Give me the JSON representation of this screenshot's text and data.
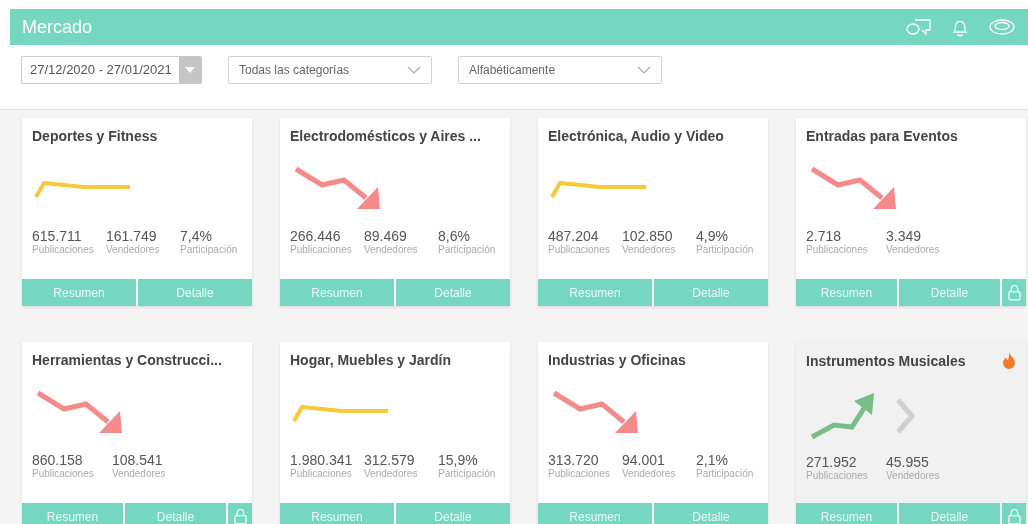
{
  "header": {
    "title": "Mercado"
  },
  "filters": {
    "date_range": "27/12/2020 - 27/01/2021",
    "category": "Todas las categorías",
    "sort": "Alfabéticamente"
  },
  "cards": [
    {
      "title": "Deportes y Fitness",
      "kind": "flat",
      "stats": [
        {
          "value": "615.711",
          "label": "Publicaciones"
        },
        {
          "value": "161.749",
          "label": "Vendedores"
        },
        {
          "value": "7,4%",
          "label": "Participación"
        }
      ],
      "buttons": [
        "Resumen",
        "Detalle"
      ],
      "locked": false,
      "hot": false,
      "highlighted": false
    },
    {
      "title": "Electrodomésticos y Aires ...",
      "kind": "down",
      "stats": [
        {
          "value": "266.446",
          "label": "Publicaciones"
        },
        {
          "value": "89.469",
          "label": "Vendedores"
        },
        {
          "value": "8,6%",
          "label": "Participación"
        }
      ],
      "buttons": [
        "Resumen",
        "Detalle"
      ],
      "locked": false,
      "hot": false,
      "highlighted": false
    },
    {
      "title": "Electrónica, Audio y Video",
      "kind": "flat",
      "stats": [
        {
          "value": "487.204",
          "label": "Publicaciones"
        },
        {
          "value": "102.850",
          "label": "Vendedores"
        },
        {
          "value": "4,9%",
          "label": "Participación"
        }
      ],
      "buttons": [
        "Resumen",
        "Detalle"
      ],
      "locked": false,
      "hot": false,
      "highlighted": false
    },
    {
      "title": "Entradas para Eventos",
      "kind": "down",
      "stats": [
        {
          "value": "2.718",
          "label": "Publicaciones"
        },
        {
          "value": "3.349",
          "label": "Vendedores"
        }
      ],
      "buttons": [
        "Resumen",
        "Detalle"
      ],
      "locked": true,
      "hot": false,
      "highlighted": false
    },
    {
      "title": "Herramientas y Construcci...",
      "kind": "down",
      "stats": [
        {
          "value": "860.158",
          "label": "Publicaciones"
        },
        {
          "value": "108.541",
          "label": "Vendedores"
        }
      ],
      "buttons": [
        "Resumen",
        "Detalle"
      ],
      "locked": true,
      "hot": false,
      "highlighted": false
    },
    {
      "title": "Hogar, Muebles y Jardín",
      "kind": "flat",
      "stats": [
        {
          "value": "1.980.341",
          "label": "Publicaciones"
        },
        {
          "value": "312.579",
          "label": "Vendedores"
        },
        {
          "value": "15,9%",
          "label": "Participación"
        }
      ],
      "buttons": [
        "Resumen",
        "Detalle"
      ],
      "locked": false,
      "hot": false,
      "highlighted": false
    },
    {
      "title": "Industrias y Oficinas",
      "kind": "down",
      "stats": [
        {
          "value": "313.720",
          "label": "Publicaciones"
        },
        {
          "value": "94.001",
          "label": "Vendedores"
        },
        {
          "value": "2,1%",
          "label": "Participación"
        }
      ],
      "buttons": [
        "Resumen",
        "Detalle"
      ],
      "locked": false,
      "hot": false,
      "highlighted": false
    },
    {
      "title": "Instrumentos Musicales",
      "kind": "up",
      "stats": [
        {
          "value": "271.952",
          "label": "Publicaciones"
        },
        {
          "value": "45.955",
          "label": "Vendedores"
        }
      ],
      "buttons": [
        "Resumen",
        "Detalle"
      ],
      "locked": true,
      "hot": true,
      "highlighted": true
    }
  ]
}
